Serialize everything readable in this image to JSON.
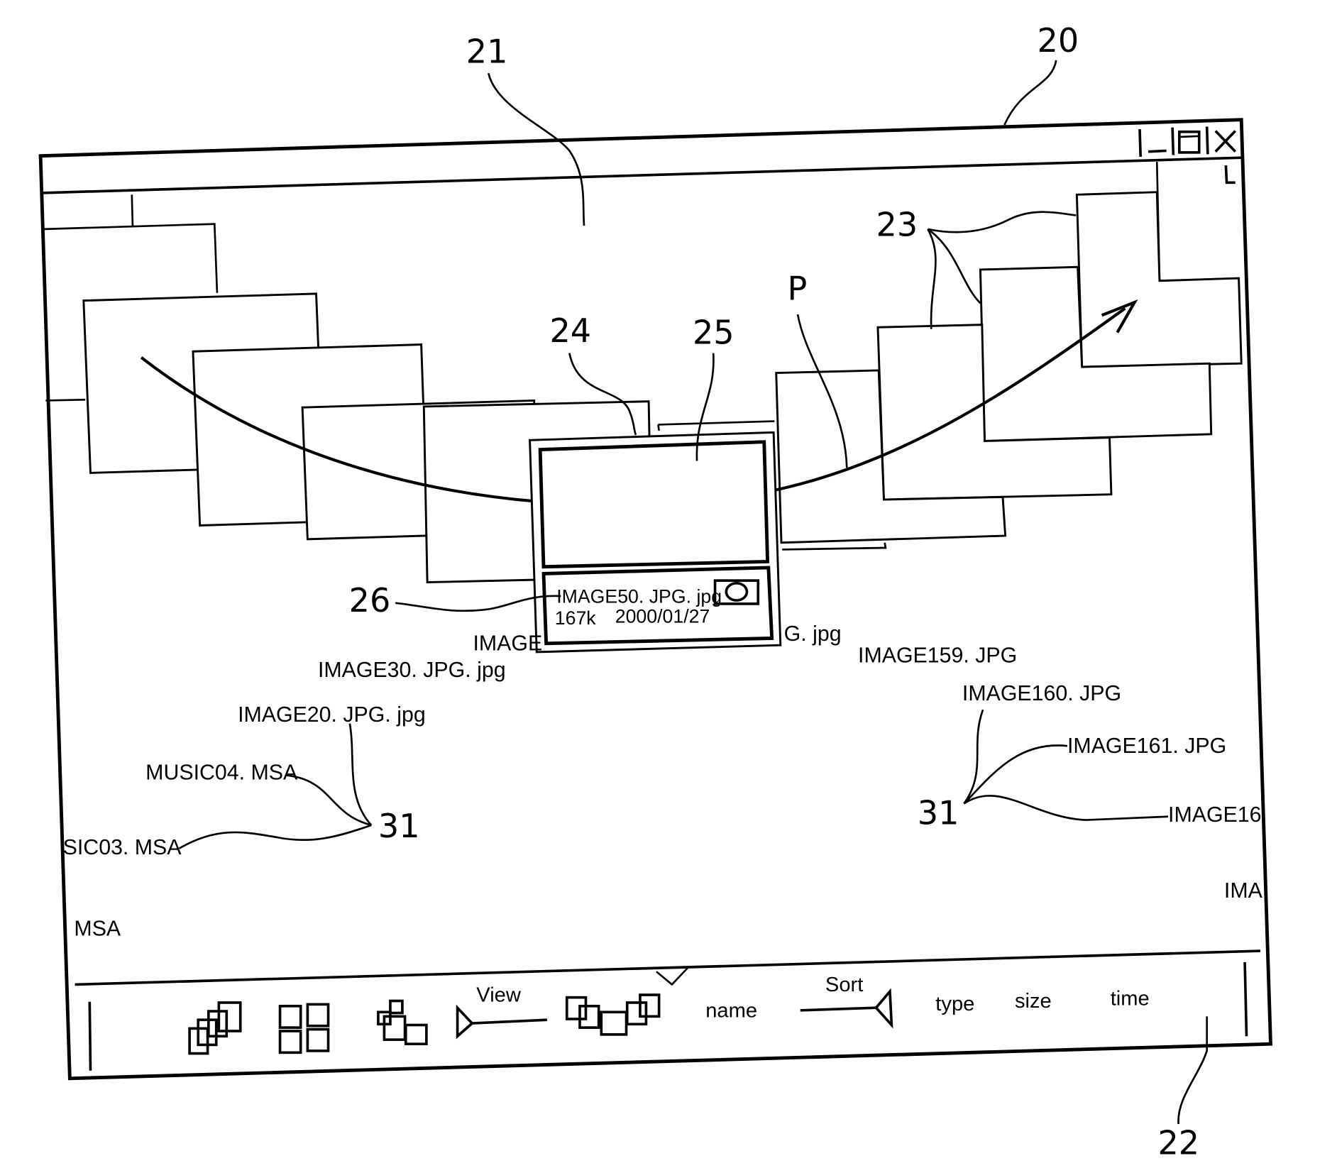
{
  "figure": {
    "reference_numerals": {
      "window": "20",
      "display_area": "21",
      "toolbar": "22",
      "thumbnails": "23",
      "focused_card": "24",
      "preview": "25",
      "info_panel": "26",
      "path": "P",
      "file_labels_left": "31",
      "file_labels_right": "31"
    }
  },
  "window": {
    "title_buttons": {
      "minimize": "_",
      "maximize": "□",
      "close": "X"
    }
  },
  "focused_item": {
    "filename": "IMAGE50. JPG. jpg",
    "size": "167k",
    "date": "2000/01/27",
    "type_icon": "circle-icon"
  },
  "file_labels": [
    {
      "id": "image-partial-left",
      "text": "IMAGE"
    },
    {
      "id": "image-partial-right",
      "text": "G. jpg"
    },
    {
      "id": "image30",
      "text": "IMAGE30. JPG. jpg"
    },
    {
      "id": "image20",
      "text": "IMAGE20. JPG. jpg"
    },
    {
      "id": "music04",
      "text": "MUSIC04. MSA"
    },
    {
      "id": "music03",
      "text": "SIC03. MSA"
    },
    {
      "id": "msa-partial",
      "text": "MSA"
    },
    {
      "id": "image159",
      "text": "IMAGE159. JPG"
    },
    {
      "id": "image160",
      "text": "IMAGE160. JPG"
    },
    {
      "id": "image161",
      "text": "IMAGE161. JPG"
    },
    {
      "id": "image162",
      "text": "IMAGE16"
    },
    {
      "id": "ima-partial",
      "text": "IMA"
    }
  ],
  "toolbar": {
    "view_label": "View",
    "sort_label": "Sort",
    "sort_options": [
      "name",
      "type",
      "size",
      "time"
    ],
    "view_icons": [
      "stack-view-icon",
      "grid-view-icon",
      "scatter-view-icon",
      "arc-view-icon"
    ]
  }
}
